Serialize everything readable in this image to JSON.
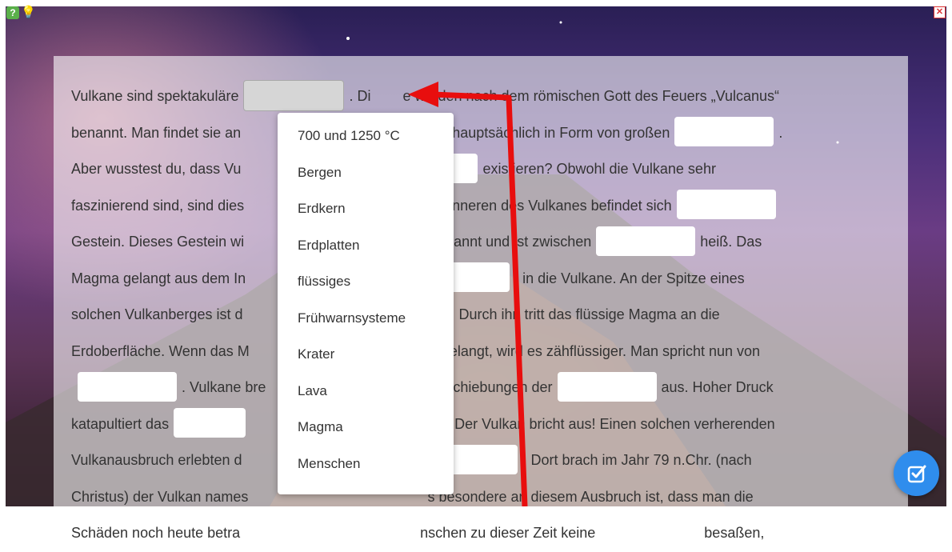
{
  "colors": {
    "accent": "#2f8ded",
    "arrow": "#e80e0e"
  },
  "icons": {
    "help": "help-icon",
    "hint": "lightbulb-icon",
    "close": "close-icon",
    "check": "checkmark-icon"
  },
  "text": {
    "l1a": "Vulkane sind spektakuläre",
    "l1b": ". Di",
    "l1c": "e wurden nach dem römischen Gott des Feuers „Vulcanus“",
    "l2a": "benannt. Man findet sie an",
    "l2b": "en sie hauptsächlich in Form von großen",
    "l2c": ".",
    "l3a": "Aber wusstest du, dass Vu",
    "l3b": "existieren? Obwohl die Vulkane sehr",
    "l4a": "faszinierend sind, sind dies",
    "l4b": "Im Inneren des Vulkanes befindet sich",
    "l5a": "Gestein. Dieses Gestein wi",
    "l5b": "genannt und ist zwischen",
    "l5c": "heiß. Das",
    "l6a": "Magma gelangt aus dem In",
    "l6b": ", in die Vulkane. An der Spitze eines",
    "l7a": "solchen Vulkanberges ist d",
    "l7b": "den. Durch ihn tritt das flüssige Magma an die",
    "l8a": "Erdoberfläche. Wenn das M",
    "l8b": "ne gelangt, wird es zähflüssiger. Man spricht nun von",
    "l9a": ". Vulkane bre",
    "l9b": "schiebungen der",
    "l9c": "aus. Hoher Druck",
    "l10a": "katapultiert das",
    "l10b": "raters. Der Vulkan bricht aus! Einen solchen verherenden",
    "l11a": "Vulkanausbruch erlebten d",
    "l11b": ". Dort brach im Jahr 79 n.Chr. (nach",
    "l12a": "Christus) der Vulkan names",
    "l12b": "s besondere an diesem Ausbruch ist, dass man die",
    "l13a": "Schäden noch heute betra",
    "l13b": "nschen zu dieser Zeit keine",
    "l13c": "besaßen,"
  },
  "dropdown": {
    "options": [
      "700 und 1250 °C",
      "Bergen",
      "Erdkern",
      "Erdplatten",
      "flüssiges",
      "Frühwarnsysteme",
      "Krater",
      "Lava",
      "Magma",
      "Menschen"
    ]
  }
}
